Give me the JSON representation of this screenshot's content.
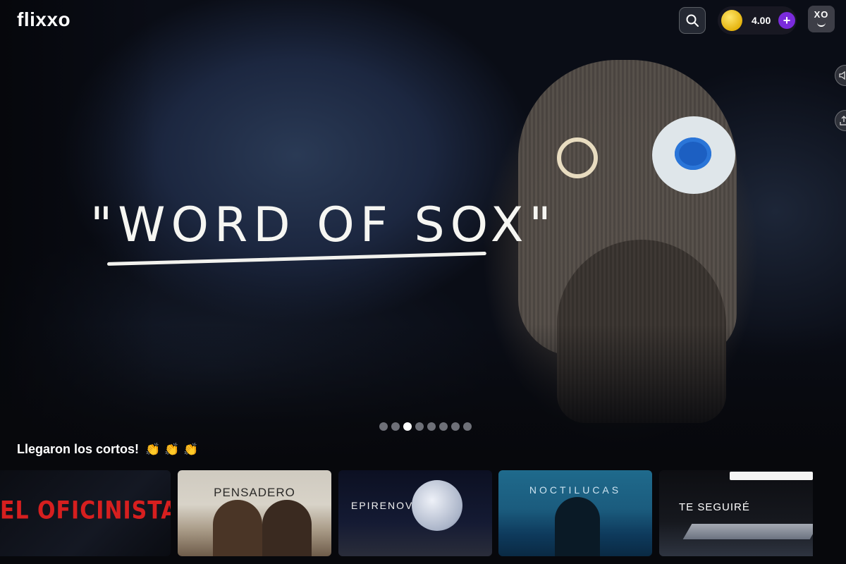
{
  "header": {
    "logo": "flixxo",
    "search_icon": "search-icon",
    "coins": {
      "value": "4.00",
      "add_label": "+"
    },
    "profile_label": "XO"
  },
  "hero": {
    "title": "\"WORD OF SOX\"",
    "carousel": {
      "count": 8,
      "active_index": 2
    }
  },
  "section": {
    "title": "Llegaron los cortos!",
    "emoji": "👏 👏 👏"
  },
  "cards": [
    {
      "title": "EL OFICINISTA"
    },
    {
      "title": "PENSADERO"
    },
    {
      "title": "EPIRENOV"
    },
    {
      "title": "NOCTILUCAS"
    },
    {
      "title": "TE SEGUIRÉ"
    }
  ],
  "colors": {
    "accent_purple": "#7a2bdc",
    "coin_gold": "#e5b40f",
    "title_red": "#d61f1f"
  }
}
